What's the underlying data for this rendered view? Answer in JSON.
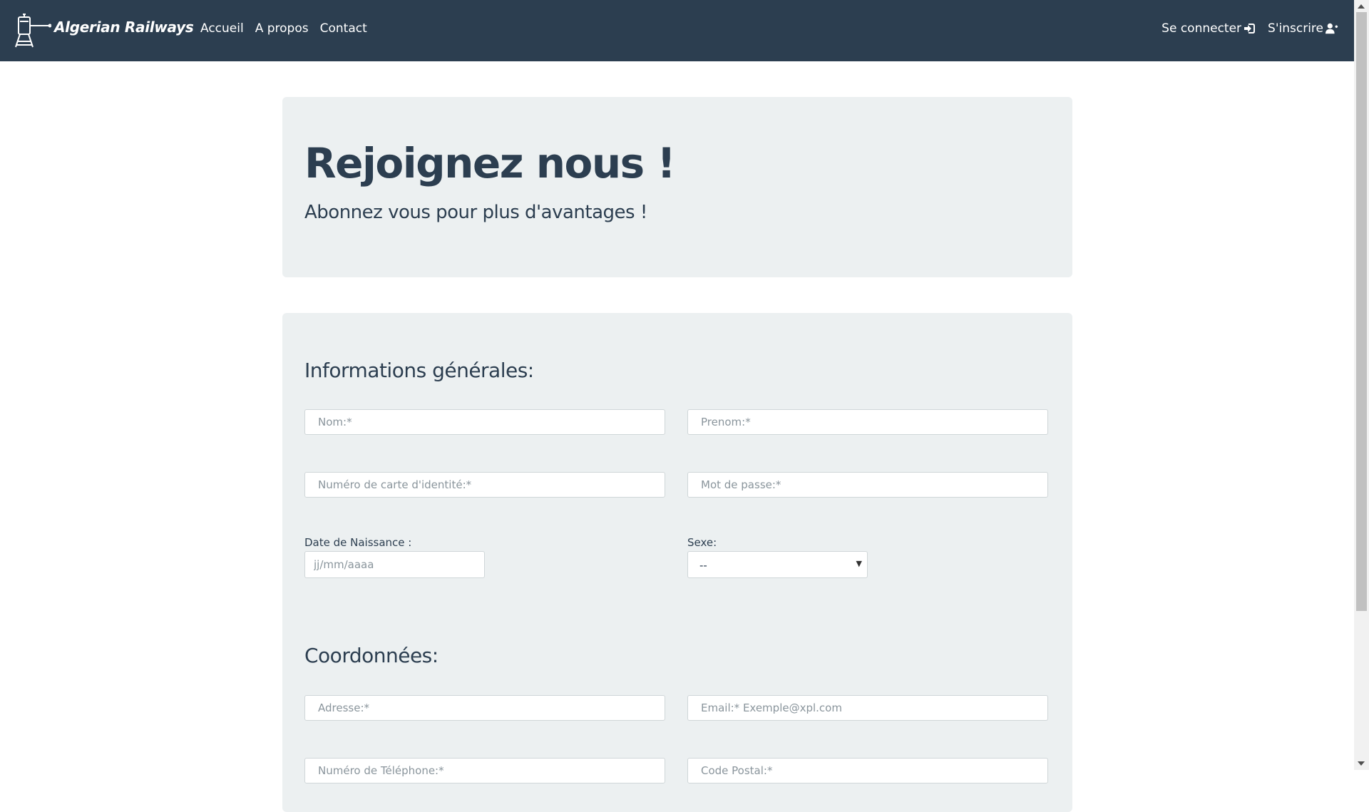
{
  "navbar": {
    "brand": "Algerian Railways",
    "links": [
      "Accueil",
      "A propos",
      "Contact"
    ],
    "login": "Se connecter",
    "signup": "S'inscrire",
    "icons": {
      "login": "sign-in-icon",
      "signup": "user-plus-icon"
    }
  },
  "hero": {
    "title": "Rejoignez nous !",
    "subtitle": "Abonnez vous pour plus d'avantages !"
  },
  "form": {
    "general_title": "Informations générales:",
    "nom_placeholder": "Nom:*",
    "prenom_placeholder": "Prenom:*",
    "id_placeholder": "Numéro de carte d'identité:*",
    "password_placeholder": "Mot de passe:*",
    "birth_label": "Date de Naissance :",
    "birth_placeholder": "jj/mm/aaaa",
    "sexe_label": "Sexe:",
    "sexe_value": "--",
    "contact_title": "Coordonnées:",
    "address_placeholder": "Adresse:*",
    "email_placeholder": "Email:* Exemple@xpl.com",
    "phone_placeholder": "Numéro de Téléphone:*",
    "postal_placeholder": "Code Postal:*"
  },
  "colors": {
    "navbar": "#2c3e50",
    "panel": "#ecf0f1",
    "text": "#2c3e50"
  }
}
